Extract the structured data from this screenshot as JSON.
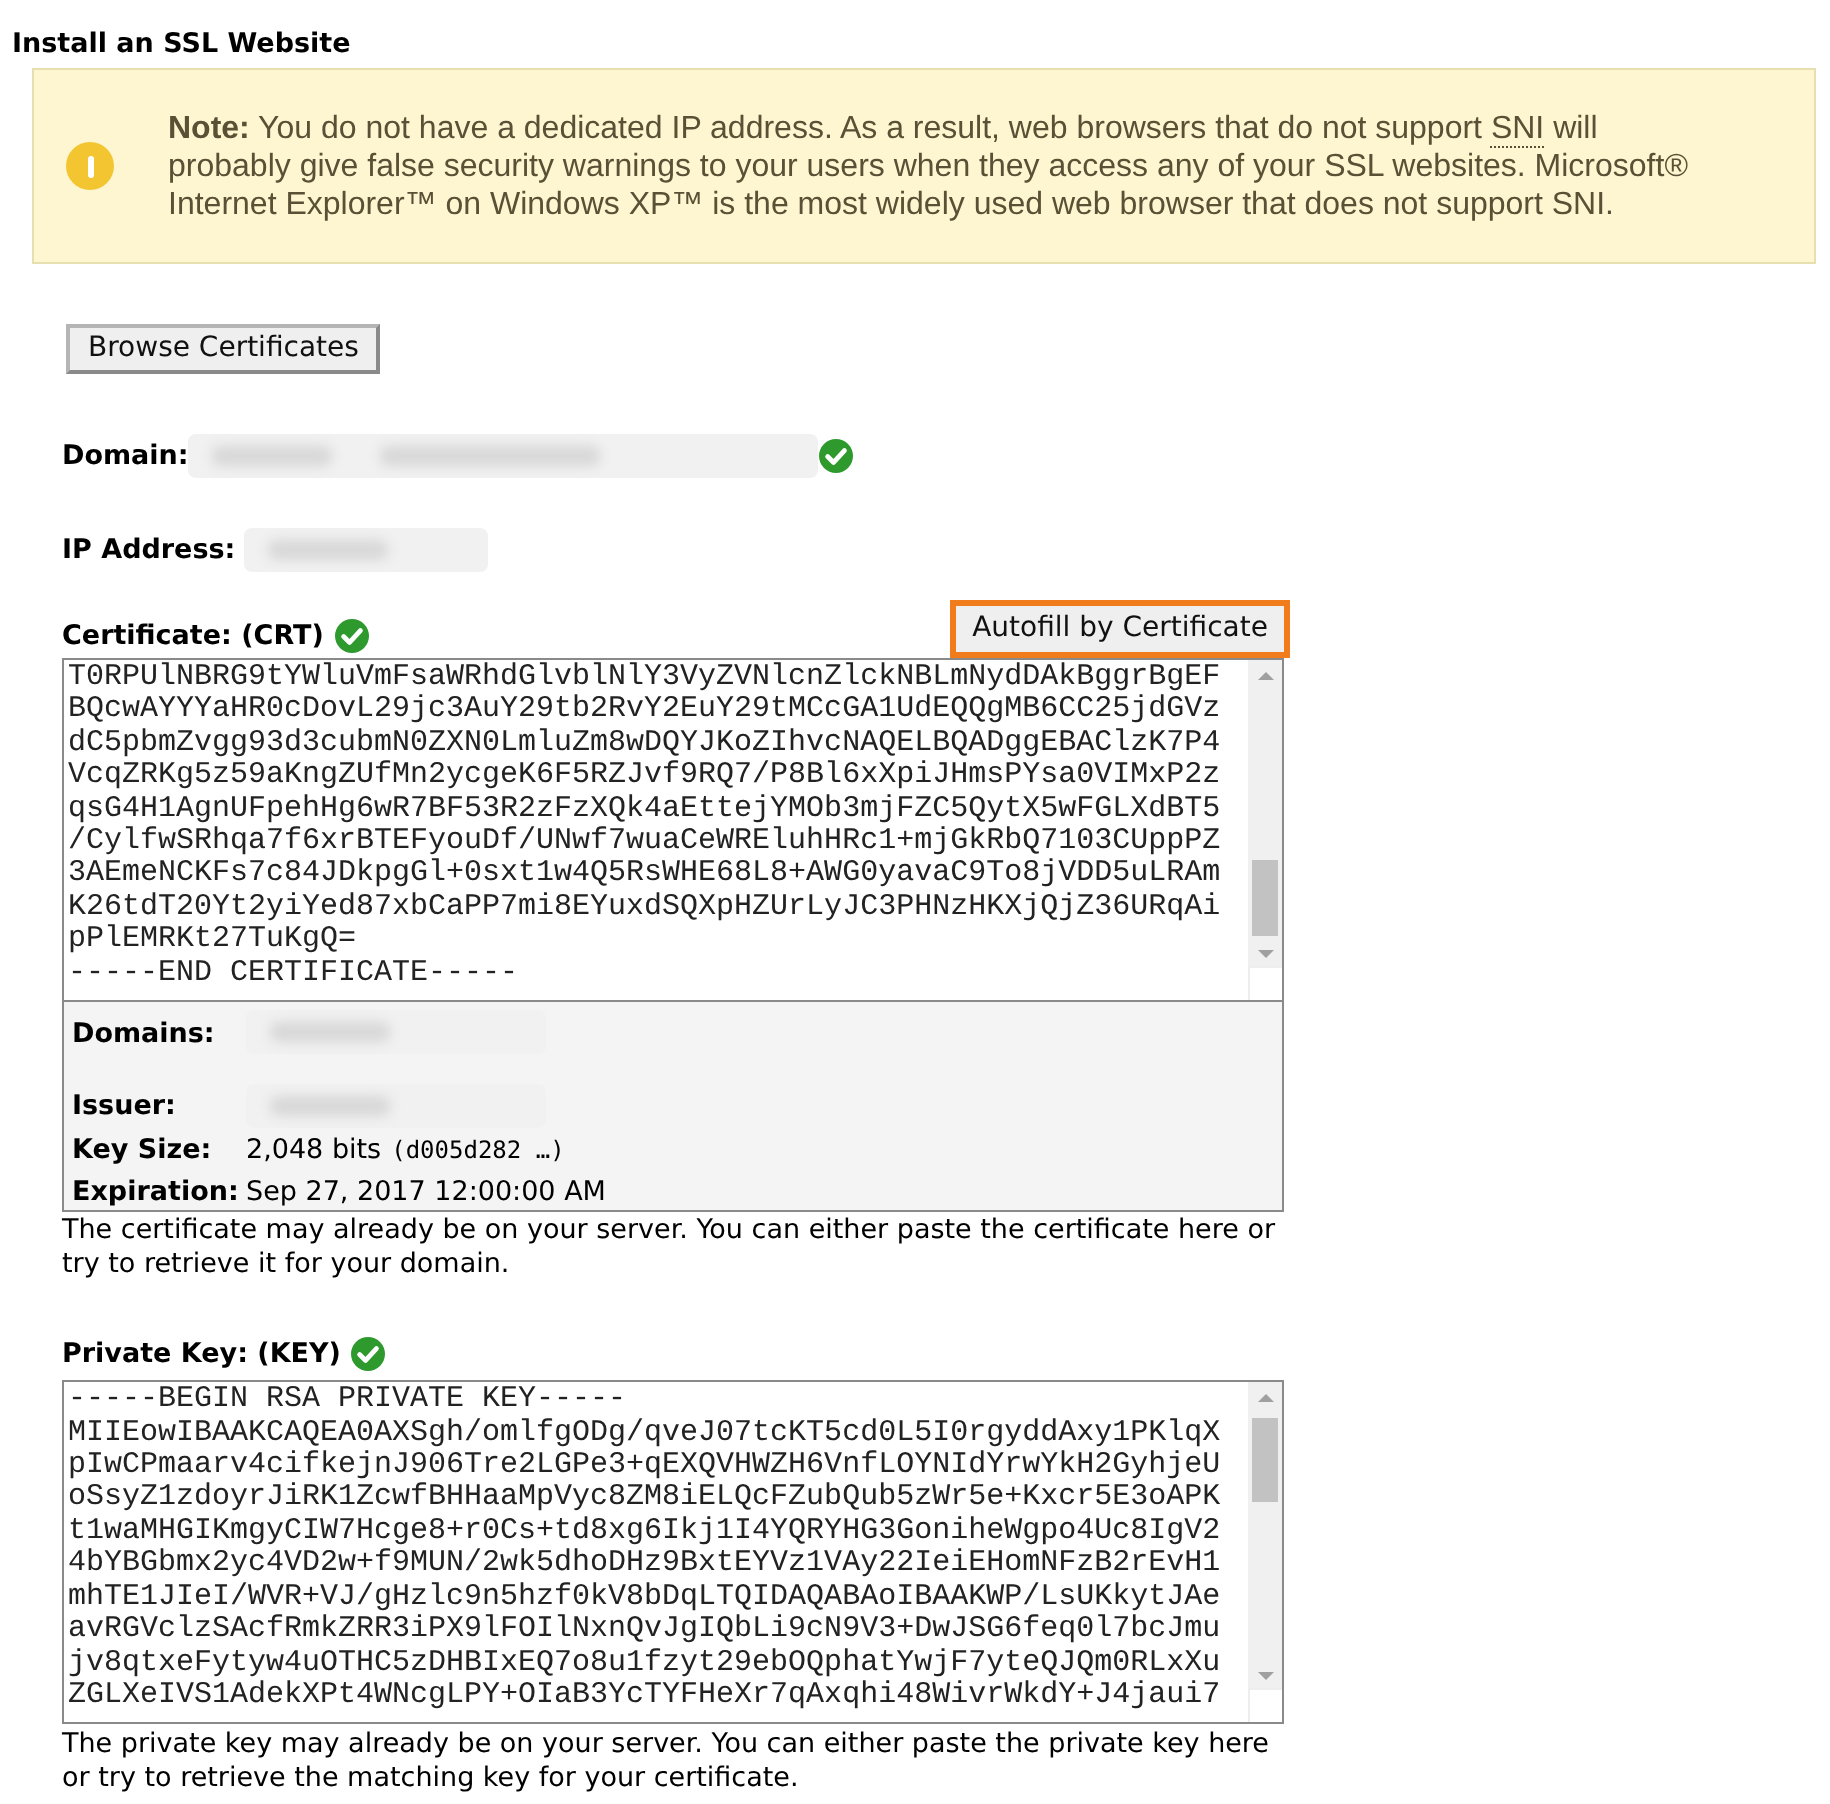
{
  "title": "Install an SSL Website",
  "note": {
    "label": "Note:",
    "text_before": "You do not have a dedicated IP address. As a result, web browsers that do not support",
    "abbr": "SNI",
    "text_after": "will probably give false security warnings to your users when they access any of your SSL websites. Microsoft® Internet Explorer™ on Windows XP™ is the most widely used web browser that does not support SNI."
  },
  "browse_button": "Browse Certificates",
  "domain": {
    "label": "Domain:",
    "verified": true
  },
  "ip_address": {
    "label": "IP Address:"
  },
  "certificate": {
    "label": "Certificate: (CRT)",
    "verified": true,
    "autofill_button": "Autofill by Certificate",
    "lines": [
      "T0RPUlNBRG9tYWluVmFsaWRhdGlvblNlY3VyZVNlcnZlckNBLmNydDAkBggrBgEF",
      "BQcwAYYYaHR0cDovL29jc3AuY29tb2RvY2EuY29tMCcGA1UdEQQgMB6CC25jdGVz",
      "dC5pbmZvgg93d3cubmN0ZXN0LmluZm8wDQYJKoZIhvcNAQELBQADggEBAClzK7P4",
      "VcqZRKg5z59aKngZUfMn2ycgeK6F5RZJvf9RQ7/P8Bl6xXpiJHmsPYsa0VIMxP2z",
      "qsG4H1AgnUFpehHg6wR7BF53R2zFzXQk4aEttejYMOb3mjFZC5QytX5wFGLXdBT5",
      "/CylfwSRhqa7f6xrBTEFyouDf/UNwf7wuaCeWREluhHRc1+mjGkRbQ7103CUppPZ",
      "3AEmeNCKFs7c84JDkpgGl+0sxt1w4Q5RsWHE68L8+AWG0yavaC9To8jVDD5uLRAm",
      "K26tdT20Yt2yiYed87xbCaPP7mi8EYuxdSQXpHZUrLyJC3PHNzHKXjQjZ36URqAi",
      "pPlEMRKt27TuKgQ=",
      "-----END CERTIFICATE-----"
    ],
    "details": {
      "domains_label": "Domains:",
      "issuer_label": "Issuer:",
      "key_size_label": "Key Size:",
      "key_size": "2,048 bits",
      "fingerprint": "(d005d282 …)",
      "expiration_label": "Expiration:",
      "expiration": "Sep 27, 2017 12:00:00 AM"
    },
    "help": "The certificate may already be on your server. You can either paste the certificate here or try to retrieve it for your domain."
  },
  "private_key": {
    "label": "Private Key: (KEY)",
    "verified": true,
    "lines": [
      "-----BEGIN RSA PRIVATE KEY-----",
      "MIIEowIBAAKCAQEA0AXSgh/omlfgODg/qveJ07tcKT5cd0L5I0rgyddAxy1PKlqX",
      "pIwCPmaarv4cifkejnJ906Tre2LGPe3+qEXQVHWZH6VnfLOYNIdYrwYkH2GyhjeU",
      "oSsyZ1zdoyrJiRK1ZcwfBHHaaMpVyc8ZM8iELQcFZubQub5zWr5e+Kxcr5E3oAPK",
      "t1waMHGIKmgyCIW7Hcge8+r0Cs+td8xg6Ikj1I4YQRYHG3GoniheWgpo4Uc8IgV2",
      "4bYBGbmx2yc4VD2w+f9MUN/2wk5dhoDHz9BxtEYVz1VAy22IeiEHomNFzB2rEvH1",
      "mhTE1JIeI/WVR+VJ/gHzlc9n5hzf0kV8bDqLTQIDAQABAoIBAAKWP/LsUKkytJAe",
      "avRGVclzSAcfRmkZRR3iPX9lFOIlNxnQvJgIQbLi9cN9V3+DwJSG6feq0l7bcJmu",
      "jv8qtxeFytyw4uOTHC5zDHBIxEQ7o8u1fzyt29ebOQphatYwjF7yteQJQm0RLxXu",
      "ZGLXeIVS1AdekXPt4WNcgLPY+OIaB3YcTYFHeXr7qAxqhi48WivrWkdY+J4jaui7"
    ],
    "help": "The private key may already be on your server. You can either paste the private key here or try to retrieve the matching key for your certificate."
  }
}
